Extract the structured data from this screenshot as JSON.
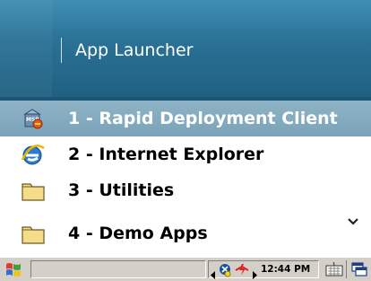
{
  "header": {
    "title": "App Launcher"
  },
  "items": [
    {
      "label": "1 - Rapid Deployment Client",
      "icon": "msp-package-icon",
      "selected": true
    },
    {
      "label": "2 - Internet Explorer",
      "icon": "internet-explorer-icon",
      "selected": false
    },
    {
      "label": "3 - Utilities",
      "icon": "folder-icon",
      "selected": false
    },
    {
      "label": "4 - Demo Apps",
      "icon": "folder-icon",
      "selected": false
    }
  ],
  "taskbar": {
    "clock": "12:44 PM"
  },
  "icons": {
    "start": "windows-flag-icon",
    "more": "chevron-down-icon",
    "tray_left": "tray-arrow-left-icon",
    "tray_right": "tray-arrow-right-icon",
    "network": "network-status-icon",
    "power": "power-status-icon",
    "keyboard": "keyboard-icon",
    "desktop": "desktop-icon"
  },
  "colors": {
    "header": "#2a7296",
    "selected_row": "#86abbf",
    "taskbar": "#d4d0c8"
  }
}
